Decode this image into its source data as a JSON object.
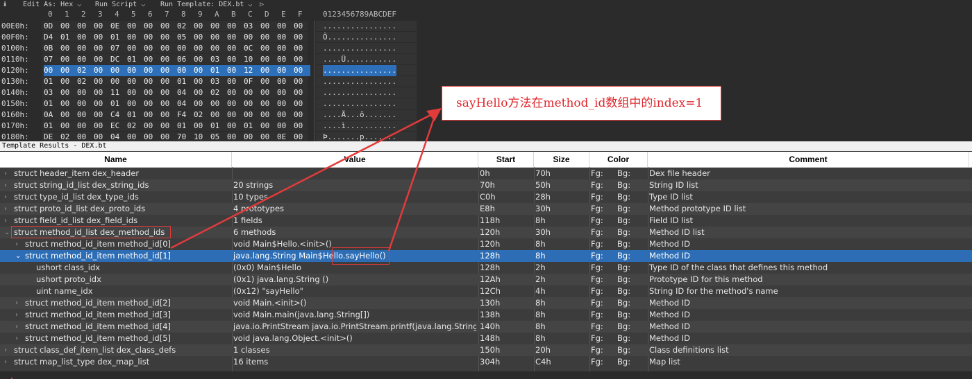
{
  "toolbar": {
    "edit_as": "Edit As: Hex",
    "run_script": "Run Script",
    "run_template": "Run Template: DEX.bt"
  },
  "hex": {
    "column_digits": [
      "0",
      "1",
      "2",
      "3",
      "4",
      "5",
      "6",
      "7",
      "8",
      "9",
      "A",
      "B",
      "C",
      "D",
      "E",
      "F"
    ],
    "ascii_header": "0123456789ABCDEF",
    "rows": [
      {
        "addr": "00E0h:",
        "bytes": [
          "0D",
          "00",
          "00",
          "00",
          "0E",
          "00",
          "00",
          "00",
          "02",
          "00",
          "00",
          "00",
          "03",
          "00",
          "00",
          "00"
        ],
        "ascii": "................"
      },
      {
        "addr": "00F0h:",
        "bytes": [
          "D4",
          "01",
          "00",
          "00",
          "01",
          "00",
          "00",
          "00",
          "05",
          "00",
          "00",
          "00",
          "00",
          "00",
          "00",
          "00"
        ],
        "ascii": "Ô..............."
      },
      {
        "addr": "0100h:",
        "bytes": [
          "0B",
          "00",
          "00",
          "00",
          "07",
          "00",
          "00",
          "00",
          "00",
          "00",
          "00",
          "00",
          "0C",
          "00",
          "00",
          "00"
        ],
        "ascii": "................"
      },
      {
        "addr": "0110h:",
        "bytes": [
          "07",
          "00",
          "00",
          "00",
          "DC",
          "01",
          "00",
          "00",
          "06",
          "00",
          "03",
          "00",
          "10",
          "00",
          "00",
          "00"
        ],
        "ascii": "....Ü..........."
      },
      {
        "addr": "0120h:",
        "bytes": [
          "00",
          "00",
          "02",
          "00",
          "00",
          "00",
          "00",
          "00",
          "00",
          "00",
          "01",
          "00",
          "12",
          "00",
          "00",
          "00"
        ],
        "ascii": "................"
      },
      {
        "addr": "0130h:",
        "bytes": [
          "01",
          "00",
          "02",
          "00",
          "00",
          "00",
          "00",
          "00",
          "01",
          "00",
          "03",
          "00",
          "0F",
          "00",
          "00",
          "00"
        ],
        "ascii": "................"
      },
      {
        "addr": "0140h:",
        "bytes": [
          "03",
          "00",
          "00",
          "00",
          "11",
          "00",
          "00",
          "00",
          "04",
          "00",
          "02",
          "00",
          "00",
          "00",
          "00",
          "00"
        ],
        "ascii": "................"
      },
      {
        "addr": "0150h:",
        "bytes": [
          "01",
          "00",
          "00",
          "00",
          "01",
          "00",
          "00",
          "00",
          "04",
          "00",
          "00",
          "00",
          "00",
          "00",
          "00",
          "00"
        ],
        "ascii": "................"
      },
      {
        "addr": "0160h:",
        "bytes": [
          "0A",
          "00",
          "00",
          "00",
          "C4",
          "01",
          "00",
          "00",
          "F4",
          "02",
          "00",
          "00",
          "00",
          "00",
          "00",
          "00"
        ],
        "ascii": "....Ä...ô......."
      },
      {
        "addr": "0170h:",
        "bytes": [
          "01",
          "00",
          "00",
          "00",
          "EC",
          "02",
          "00",
          "00",
          "01",
          "00",
          "01",
          "00",
          "01",
          "00",
          "00",
          "00"
        ],
        "ascii": "....ì..........."
      },
      {
        "addr": "0180h:",
        "bytes": [
          "DE",
          "02",
          "00",
          "00",
          "04",
          "00",
          "00",
          "00",
          "70",
          "10",
          "05",
          "00",
          "00",
          "00",
          "0E",
          "00"
        ],
        "ascii": "Þ.......p......."
      }
    ]
  },
  "template": {
    "panel_title": "Template Results - DEX.bt",
    "columns": {
      "name": "Name",
      "value": "Value",
      "start": "Start",
      "size": "Size",
      "color": "Color",
      "comment": "Comment"
    },
    "rows": [
      {
        "indent": 0,
        "exp": ">",
        "name": "struct header_item dex_header",
        "value": "",
        "start": "0h",
        "size": "70h",
        "fg": "Fg:",
        "bg": "Bg:",
        "comment": "Dex file header"
      },
      {
        "indent": 0,
        "exp": ">",
        "name": "struct string_id_list dex_string_ids",
        "value": "20 strings",
        "start": "70h",
        "size": "50h",
        "fg": "Fg:",
        "bg": "Bg:",
        "comment": "String ID list"
      },
      {
        "indent": 0,
        "exp": ">",
        "name": "struct type_id_list dex_type_ids",
        "value": "10 types",
        "start": "C0h",
        "size": "28h",
        "fg": "Fg:",
        "bg": "Bg:",
        "comment": "Type ID list"
      },
      {
        "indent": 0,
        "exp": ">",
        "name": "struct proto_id_list dex_proto_ids",
        "value": "4 prototypes",
        "start": "E8h",
        "size": "30h",
        "fg": "Fg:",
        "bg": "Bg:",
        "comment": "Method prototype ID list"
      },
      {
        "indent": 0,
        "exp": ">",
        "name": "struct field_id_list dex_field_ids",
        "value": "1 fields",
        "start": "118h",
        "size": "8h",
        "fg": "Fg:",
        "bg": "Bg:",
        "comment": "Field ID list"
      },
      {
        "indent": 0,
        "exp": "v",
        "name": "struct method_id_list dex_method_ids",
        "value": "6 methods",
        "start": "120h",
        "size": "30h",
        "fg": "Fg:",
        "bg": "Bg:",
        "comment": "Method ID list"
      },
      {
        "indent": 1,
        "exp": ">",
        "name": "struct method_id_item method_id[0]",
        "value": "void Main$Hello.<init>()",
        "start": "120h",
        "size": "8h",
        "fg": "Fg:",
        "bg": "Bg:",
        "comment": "Method ID"
      },
      {
        "indent": 1,
        "exp": "v",
        "name": "struct method_id_item method_id[1]",
        "value": "java.lang.String Main$Hello.sayHello()",
        "start": "128h",
        "size": "8h",
        "fg": "Fg:",
        "bg": "Bg:",
        "comment": "Method ID"
      },
      {
        "indent": 2,
        "exp": "",
        "name": "ushort class_idx",
        "value": "(0x0) Main$Hello",
        "start": "128h",
        "size": "2h",
        "fg": "Fg:",
        "bg": "Bg:",
        "comment": "Type ID of the class that defines this method"
      },
      {
        "indent": 2,
        "exp": "",
        "name": "ushort proto_idx",
        "value": "(0x1) java.lang.String ()",
        "start": "12Ah",
        "size": "2h",
        "fg": "Fg:",
        "bg": "Bg:",
        "comment": "Prototype ID for this method"
      },
      {
        "indent": 2,
        "exp": "",
        "name": "uint name_idx",
        "value": "(0x12) \"sayHello\"",
        "start": "12Ch",
        "size": "4h",
        "fg": "Fg:",
        "bg": "Bg:",
        "comment": "String ID for the method's name"
      },
      {
        "indent": 1,
        "exp": ">",
        "name": "struct method_id_item method_id[2]",
        "value": "void Main.<init>()",
        "start": "130h",
        "size": "8h",
        "fg": "Fg:",
        "bg": "Bg:",
        "comment": "Method ID"
      },
      {
        "indent": 1,
        "exp": ">",
        "name": "struct method_id_item method_id[3]",
        "value": "void Main.main(java.lang.String[])",
        "start": "138h",
        "size": "8h",
        "fg": "Fg:",
        "bg": "Bg:",
        "comment": "Method ID"
      },
      {
        "indent": 1,
        "exp": ">",
        "name": "struct method_id_item method_id[4]",
        "value": "java.io.PrintStream java.io.PrintStream.printf(java.lang.String, jav...",
        "start": "140h",
        "size": "8h",
        "fg": "Fg:",
        "bg": "Bg:",
        "comment": "Method ID"
      },
      {
        "indent": 1,
        "exp": ">",
        "name": "struct method_id_item method_id[5]",
        "value": "void java.lang.Object.<init>()",
        "start": "148h",
        "size": "8h",
        "fg": "Fg:",
        "bg": "Bg:",
        "comment": "Method ID"
      },
      {
        "indent": 0,
        "exp": ">",
        "name": "struct class_def_item_list dex_class_defs",
        "value": "1 classes",
        "start": "150h",
        "size": "20h",
        "fg": "Fg:",
        "bg": "Bg:",
        "comment": "Class definitions list"
      },
      {
        "indent": 0,
        "exp": ">",
        "name": "struct map_list_type dex_map_list",
        "value": "16 items",
        "start": "304h",
        "size": "C4h",
        "fg": "Fg:",
        "bg": "Bg:",
        "comment": "Map list"
      }
    ],
    "selected_row": 7
  },
  "annotation": {
    "callout_text": "sayHello方法在method_id数组中的index=1",
    "color": "#e23b3b"
  }
}
